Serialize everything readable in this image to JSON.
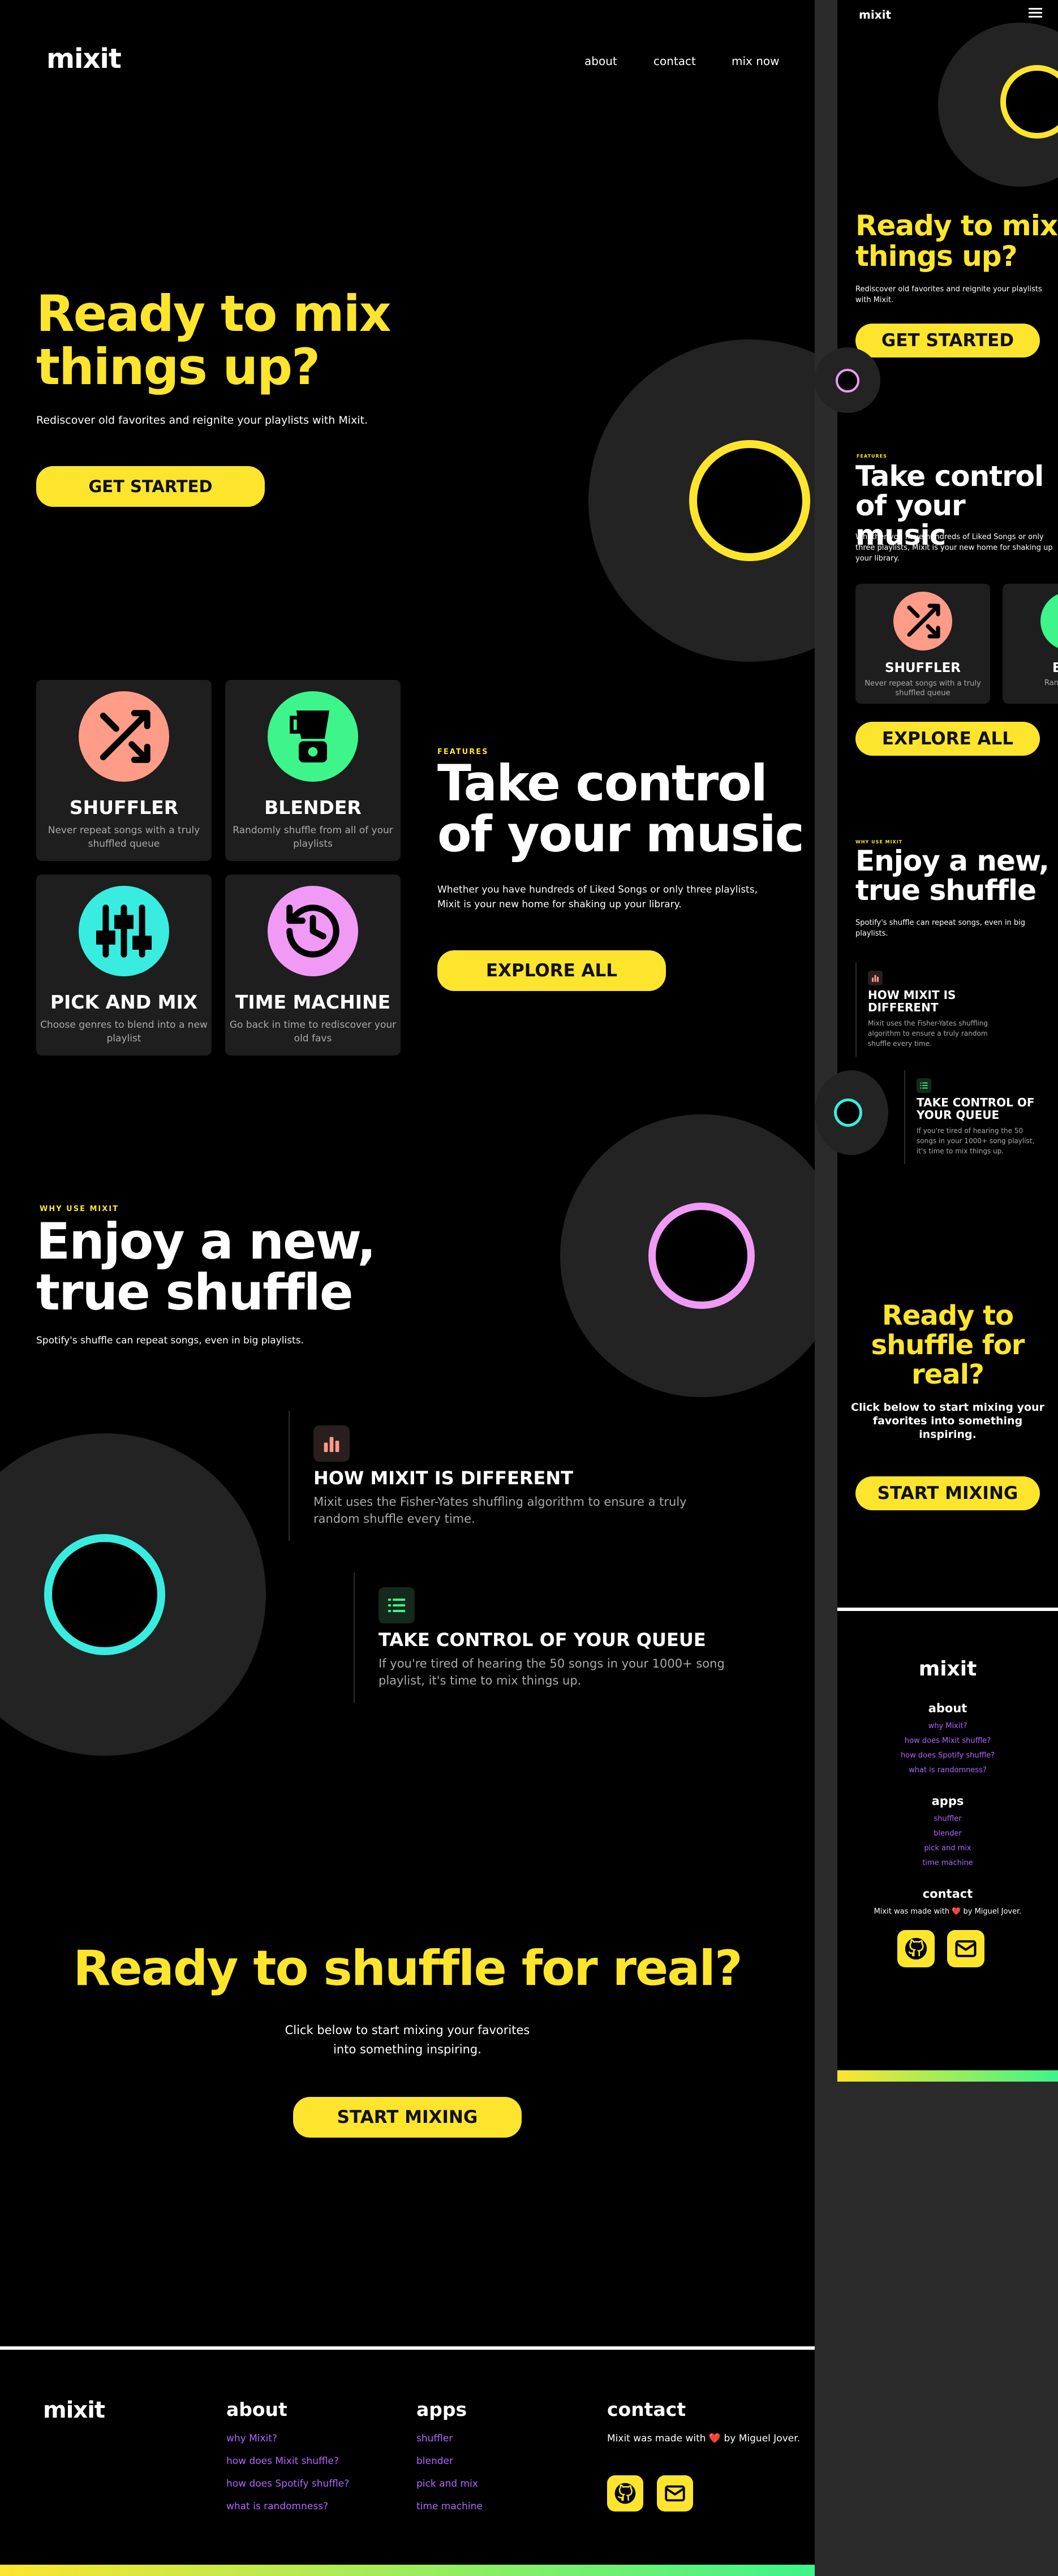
{
  "brand": "mixit",
  "nav": {
    "about": "about",
    "contact": "contact",
    "mix_now": "mix now"
  },
  "hero": {
    "title_line1": "Ready to mix",
    "title_line2": "things up?",
    "subtitle": "Rediscover old favorites and reignite your playlists with Mixit.",
    "cta": "GET STARTED"
  },
  "features": {
    "eyebrow": "FEATURES",
    "title_line1": "Take control",
    "title_line2": "of your music",
    "description_line1": "Whether you have hundreds of Liked Songs or only three playlists,",
    "description_line2": "Mixit is your new home for shaking up your library.",
    "cta": "EXPLORE ALL",
    "cards": [
      {
        "title": "SHUFFLER",
        "desc_line1": "Never repeat songs with a truly",
        "desc_line2": "shuffled queue",
        "icon": "shuffle-icon",
        "color": "#ff9c88"
      },
      {
        "title": "BLENDER",
        "desc_line1": "Randomly shuffle from all of your",
        "desc_line2": "playlists",
        "icon": "blender-icon",
        "color": "#3df58a"
      },
      {
        "title": "PICK AND MIX",
        "desc_line1": "Choose genres to blend into a new",
        "desc_line2": "playlist",
        "icon": "sliders-icon",
        "color": "#39ece0"
      },
      {
        "title": "TIME MACHINE",
        "desc_line1": "Go back in time to rediscover your",
        "desc_line2": "old favs",
        "icon": "history-icon",
        "color": "#f09af5"
      }
    ]
  },
  "why": {
    "eyebrow": "WHY USE MIXIT",
    "title_line1": "Enjoy a new,",
    "title_line2": "true shuffle",
    "subtitle": "Spotify's shuffle can repeat songs, even in big playlists.",
    "items": [
      {
        "title": "HOW MIXIT IS DIFFERENT",
        "desc_line1": "Mixit uses the Fisher-Yates shuffling algorithm to ensure a truly",
        "desc_line2": "random shuffle every time.",
        "icon": "bar-chart-icon"
      },
      {
        "title": "TAKE CONTROL OF YOUR QUEUE",
        "desc_line1": "If you're tired of hearing the 50 songs in your 1000+ song",
        "desc_line2": "playlist, it's time to mix things up.",
        "icon": "list-icon"
      }
    ]
  },
  "cta_section": {
    "title": "Ready to shuffle for real?",
    "subtitle_line1": "Click below to start mixing your favorites",
    "subtitle_line2": "into something inspiring.",
    "cta": "START MIXING"
  },
  "footer": {
    "about": {
      "heading": "about",
      "links": [
        "why Mixit?",
        "how does Mixit shuffle?",
        "how does Spotify shuffle?",
        "what is randomness?"
      ]
    },
    "apps": {
      "heading": "apps",
      "links": [
        "shuffler",
        "blender",
        "pick and mix",
        "time machine"
      ]
    },
    "contact": {
      "heading": "contact",
      "text": "Mixit was made with ❤️ by Miguel Jover."
    }
  },
  "mobile": {
    "hero_title_line1": "Ready to mix",
    "hero_title_line2": "things up?",
    "hero_sub_line1": "Rediscover old favorites and reignite your playlists",
    "hero_sub_line2": "with Mixit.",
    "feat_title_line1": "Take control",
    "feat_title_line2": "of your music",
    "feat_desc_line1": "Whether you have hundreds of Liked Songs or only",
    "feat_desc_line2": "three playlists, Mixit is your new home for shaking up",
    "feat_desc_line3": "your library.",
    "card1_desc_line1": "Never repeat songs with a truly",
    "card1_desc_line2": "shuffled queue",
    "card2_title": "BL",
    "card2_desc": "Randomly sh",
    "why_sub_line1": "Spotify's shuffle can repeat songs, even in big",
    "why_sub_line2": "playlists.",
    "item1_title_line1": "HOW MIXIT IS",
    "item1_title_line2": "DIFFERENT",
    "item1_desc_line1": "Mixit uses the Fisher-Yates shuffling",
    "item1_desc_line2": "algorithm to ensure a truly random",
    "item1_desc_line3": "shuffle every time.",
    "item2_title_line1": "TAKE CONTROL OF",
    "item2_title_line2": "YOUR QUEUE",
    "item2_desc_line1": "If you're tired of hearing the 50",
    "item2_desc_line2": "songs in your 1000+ song playlist,",
    "item2_desc_line3": "it's time to mix things up.",
    "cta_title_line1": "Ready to",
    "cta_title_line2": "shuffle for",
    "cta_title_line3": "real?",
    "cta_sub_line1": "Click below to start mixing your",
    "cta_sub_line2": "favorites into something",
    "cta_sub_line3": "inspiring."
  },
  "colors": {
    "accent": "#fde52d",
    "link": "#b266ff",
    "card_bg": "#1e1e1e",
    "disc": "#232323",
    "pink": "#f09af5",
    "cyan": "#39ece0"
  }
}
